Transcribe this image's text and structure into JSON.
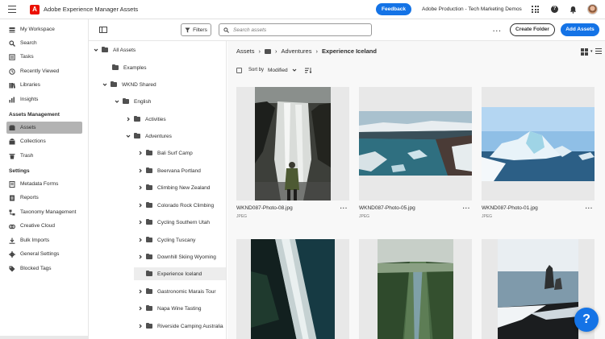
{
  "app": {
    "title": "Adobe Experience Manager Assets",
    "feedback_label": "Feedback",
    "org_name": "Adobe Production - Tech Marketing Demos"
  },
  "rail": {
    "items": [
      {
        "label": "My Workspace",
        "icon": "workspace-icon"
      },
      {
        "label": "Search",
        "icon": "search-icon"
      },
      {
        "label": "Tasks",
        "icon": "tasks-icon"
      },
      {
        "label": "Recently Viewed",
        "icon": "clock-icon"
      },
      {
        "label": "Libraries",
        "icon": "library-icon"
      },
      {
        "label": "Insights",
        "icon": "chart-icon"
      }
    ],
    "assets_heading": "Assets Management",
    "assets_items": [
      {
        "label": "Assets",
        "icon": "assets-icon",
        "selected": true
      },
      {
        "label": "Collections",
        "icon": "collections-icon"
      },
      {
        "label": "Trash",
        "icon": "trash-icon"
      }
    ],
    "settings_heading": "Settings",
    "settings_items": [
      {
        "label": "Metadata Forms",
        "icon": "form-icon"
      },
      {
        "label": "Reports",
        "icon": "report-icon"
      },
      {
        "label": "Taxonomy Management",
        "icon": "taxonomy-icon"
      },
      {
        "label": "Creative Cloud",
        "icon": "creative-cloud-icon"
      },
      {
        "label": "Bulk Imports",
        "icon": "import-icon"
      },
      {
        "label": "General Settings",
        "icon": "gear-icon"
      },
      {
        "label": "Blocked Tags",
        "icon": "blocked-tag-icon"
      }
    ]
  },
  "toolbar": {
    "filters_label": "Filters",
    "search_placeholder": "Search assets",
    "create_folder_label": "Create Folder",
    "add_assets_label": "Add Assets"
  },
  "tree": {
    "root": "All Assets",
    "items": [
      {
        "label": "Examples",
        "level": 1,
        "expanded": null
      },
      {
        "label": "WKND Shared",
        "level": 1,
        "expanded": true
      },
      {
        "label": "English",
        "level": 2,
        "expanded": true
      },
      {
        "label": "Activities",
        "level": 3,
        "expanded": false
      },
      {
        "label": "Adventures",
        "level": 3,
        "expanded": true
      },
      {
        "label": "Bali Surf Camp",
        "level": 4,
        "expanded": false
      },
      {
        "label": "Beervana Portland",
        "level": 4,
        "expanded": false
      },
      {
        "label": "Climbing New Zealand",
        "level": 4,
        "expanded": false
      },
      {
        "label": "Colorado Rock Climbing",
        "level": 4,
        "expanded": false
      },
      {
        "label": "Cycling Southern Utah",
        "level": 4,
        "expanded": false
      },
      {
        "label": "Cycling Tuscany",
        "level": 4,
        "expanded": false
      },
      {
        "label": "Downhill Skiing Wyoming",
        "level": 4,
        "expanded": false
      },
      {
        "label": "Experience Iceland",
        "level": 4,
        "expanded": null,
        "selected": true
      },
      {
        "label": "Gastronomic Marais Tour",
        "level": 4,
        "expanded": false
      },
      {
        "label": "Napa Wine Tasting",
        "level": 4,
        "expanded": false
      },
      {
        "label": "Riverside Camping Australia",
        "level": 4,
        "expanded": false
      }
    ]
  },
  "main": {
    "breadcrumb": {
      "root": "Assets",
      "parent": "Adventures",
      "current": "Experience Iceland"
    },
    "sort": {
      "label": "Sort by",
      "value": "Modified"
    },
    "cards": [
      {
        "name": "WKND087-Photo-08.jpg",
        "type": "JPEG",
        "photo": "waterfall"
      },
      {
        "name": "WKND087-Photo-05.jpg",
        "type": "JPEG",
        "photo": "lagoon"
      },
      {
        "name": "WKND087-Photo-01.jpg",
        "type": "JPEG",
        "photo": "iceberg"
      },
      {
        "name": "",
        "type": "",
        "photo": "shore-aerial"
      },
      {
        "name": "",
        "type": "",
        "photo": "canyon"
      },
      {
        "name": "",
        "type": "",
        "photo": "beach-stack"
      }
    ]
  },
  "colors": {
    "accent": "#1473e6",
    "brand_red": "#eb1000",
    "selected_rail": "#b3b3b3"
  }
}
